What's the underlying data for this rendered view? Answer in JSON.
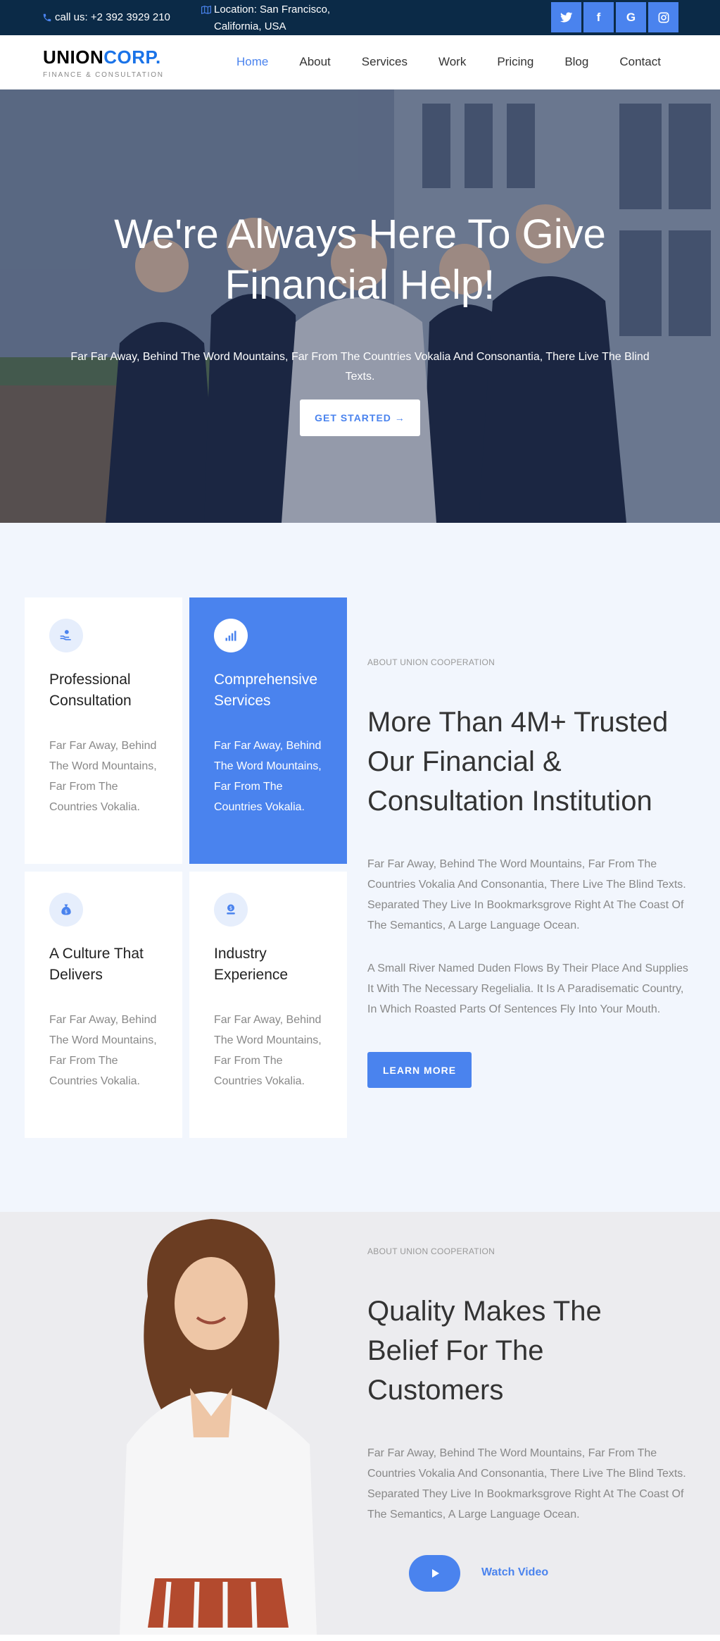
{
  "topbar": {
    "call_text": "call us: +2 392 3929 210",
    "location_text": "Location: San Francisco, California, USA",
    "socials": [
      {
        "icon": "twitter-icon",
        "glyph": "🐦"
      },
      {
        "icon": "facebook-icon",
        "glyph": "f"
      },
      {
        "icon": "google-icon",
        "glyph": "G"
      },
      {
        "icon": "instagram-icon",
        "glyph": "◎"
      }
    ]
  },
  "brand": {
    "name_part1": "UNION",
    "name_part2": "CORP.",
    "tagline": "FINANCE & CONSULTATION"
  },
  "nav": {
    "items": [
      {
        "label": "Home",
        "active": true
      },
      {
        "label": "About"
      },
      {
        "label": "Services"
      },
      {
        "label": "Work"
      },
      {
        "label": "Pricing"
      },
      {
        "label": "Blog"
      },
      {
        "label": "Contact"
      }
    ]
  },
  "hero": {
    "title": "We're Always Here To Give Financial Help!",
    "subtitle": "Far Far Away, Behind The Word Mountains, Far From The Countries Vokalia And Consonantia, There Live The Blind Texts.",
    "cta": "GET STARTED →"
  },
  "features": [
    {
      "icon": "hand-coin-icon",
      "title": "Professional Consultation",
      "text": "Far Far Away, Behind The Word Mountains, Far From The Countries Vokalia."
    },
    {
      "icon": "bar-chart-icon",
      "title": "Comprehensive Services",
      "text": "Far Far Away, Behind The Word Mountains, Far From The Countries Vokalia."
    },
    {
      "icon": "money-bag-icon",
      "title": "A Culture That Delivers",
      "text": "Far Far Away, Behind The Word Mountains, Far From The Countries Vokalia."
    },
    {
      "icon": "coin-stack-icon",
      "title": "Industry Experience",
      "text": "Far Far Away, Behind The Word Mountains, Far From The Countries Vokalia."
    }
  ],
  "about": {
    "eyebrow": "ABOUT UNION COOPERATION",
    "heading": "More Than 4M+ Trusted Our Financial & Consultation Institution",
    "para1": "Far Far Away, Behind The Word Mountains, Far From The Countries Vokalia And Consonantia, There Live The Blind Texts. Separated They Live In Bookmarksgrove Right At The Coast Of The Semantics, A Large Language Ocean.",
    "para2": "A Small River Named Duden Flows By Their Place And Supplies It With The Necessary Regelialia. It Is A Paradisematic Country, In Which Roasted Parts Of Sentences Fly Into Your Mouth.",
    "button": "LEARN MORE"
  },
  "quality": {
    "eyebrow": "ABOUT UNION COOPERATION",
    "heading": "Quality Makes The Belief For The Customers",
    "para": "Far Far Away, Behind The Word Mountains, Far From The Countries Vokalia And Consonantia, There Live The Blind Texts. Separated They Live In Bookmarksgrove Right At The Coast Of The Semantics, A Large Language Ocean.",
    "watch_label": "Watch Video"
  },
  "colors": {
    "accent": "#4a83ee",
    "topbar_bg": "#0b2a47",
    "section_bg": "#f2f6fd"
  }
}
